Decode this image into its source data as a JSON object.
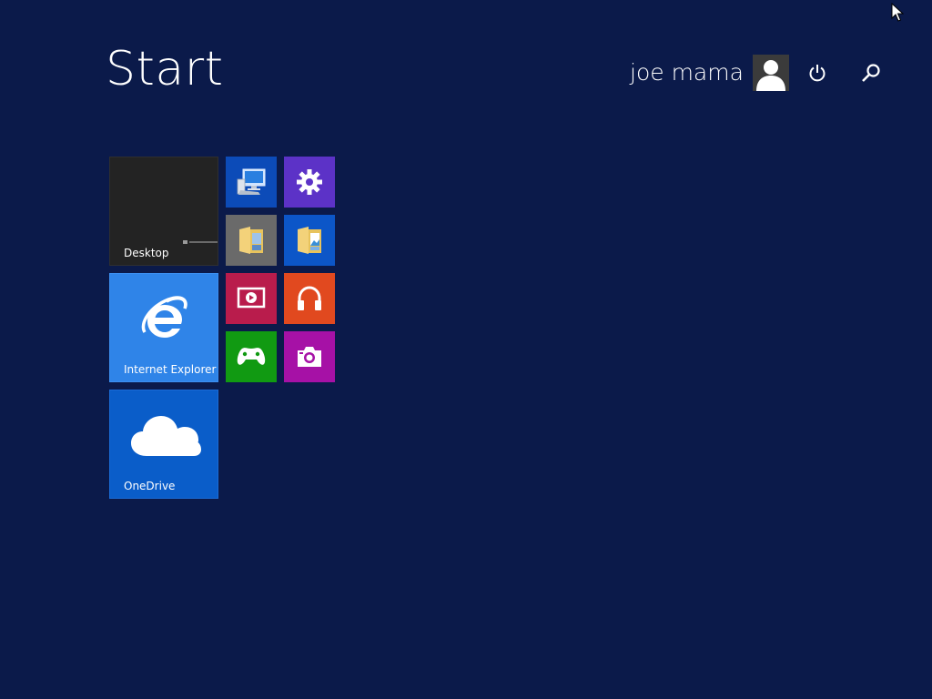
{
  "screen": {
    "title": "Start"
  },
  "user": {
    "name": "joe mama"
  },
  "icons": {
    "avatar": "user-avatar-icon",
    "power": "power-icon",
    "search": "search-icon",
    "cursor": "mouse-pointer-icon"
  },
  "tiles": {
    "desktop": {
      "label": "Desktop",
      "color": "#232323"
    },
    "ie": {
      "label": "Internet Explorer",
      "color": "#2f84e8"
    },
    "onedrive": {
      "label": "OneDrive",
      "color": "#0a5dc9"
    },
    "this_pc": {
      "icon": "computer-icon",
      "color": "#0c4bb8"
    },
    "settings": {
      "icon": "gear-icon",
      "color": "#5c32c7"
    },
    "file_explorer": {
      "icon": "folder-icon",
      "color": "#6a6a6a"
    },
    "photos": {
      "icon": "photos-folder-icon",
      "color": "#0c56c8"
    },
    "video": {
      "icon": "video-icon",
      "color": "#b91c4c"
    },
    "music": {
      "icon": "headphones-icon",
      "color": "#e1491f"
    },
    "games": {
      "icon": "controller-icon",
      "color": "#119a12"
    },
    "camera": {
      "icon": "camera-icon",
      "color": "#a611a6"
    }
  },
  "colors": {
    "background": "#0b1a4a",
    "text": "#ffffff"
  }
}
